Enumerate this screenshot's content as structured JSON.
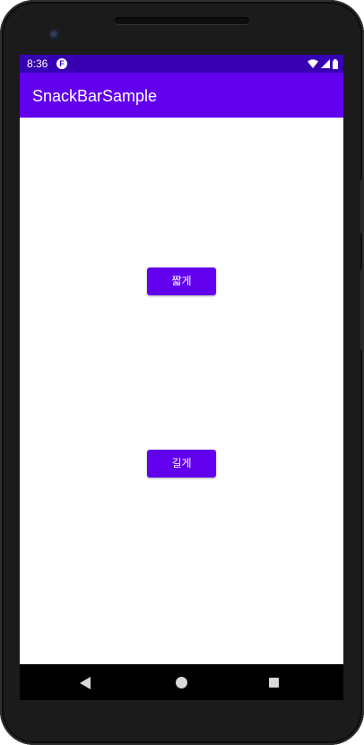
{
  "status_bar": {
    "time": "8:36",
    "notification_icon": "F",
    "icons": [
      "wifi-icon",
      "signal-icon",
      "battery-icon"
    ],
    "background": "#3700b3"
  },
  "app_bar": {
    "title": "SnackBarSample",
    "background": "#6200ee"
  },
  "buttons": {
    "short_label": "짧게",
    "long_label": "길게",
    "color": "#6200ee"
  },
  "snackbar": {
    "color": "#6200ee"
  },
  "nav_bar": {
    "icons": [
      "back-icon",
      "home-icon",
      "recents-icon"
    ]
  }
}
